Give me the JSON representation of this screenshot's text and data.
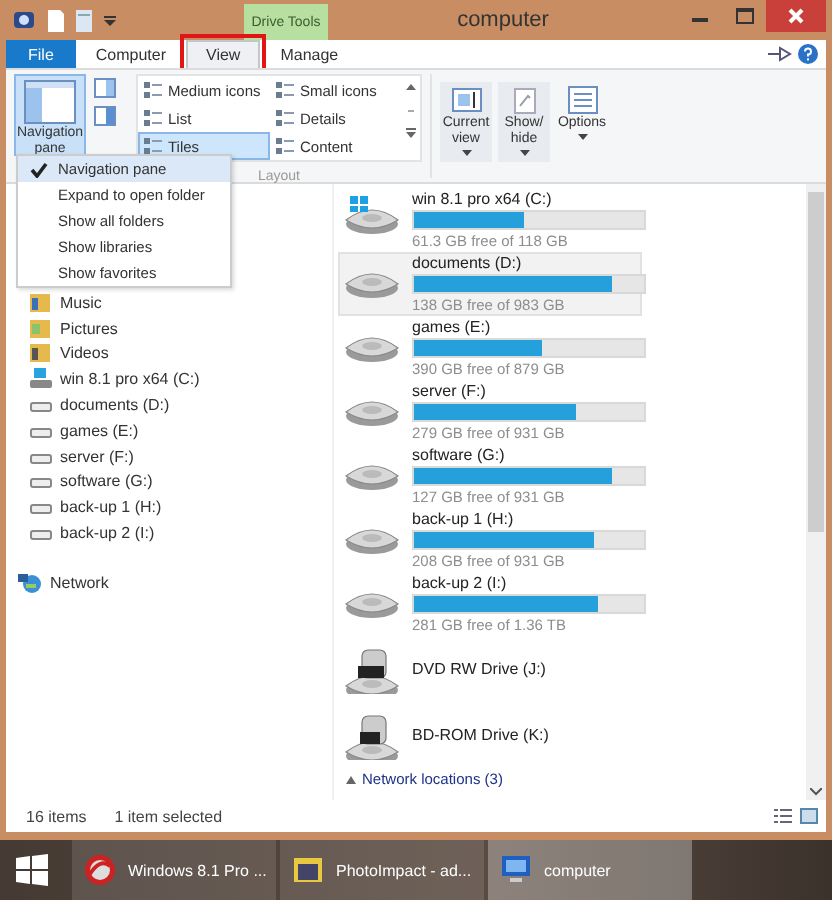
{
  "window": {
    "title": "computer",
    "contextual_tab": "Drive Tools"
  },
  "tabs": [
    {
      "label": "File",
      "kind": "file",
      "selected": false,
      "highlighted": false
    },
    {
      "label": "Computer",
      "kind": "tab",
      "selected": false,
      "highlighted": false
    },
    {
      "label": "View",
      "kind": "tab",
      "selected": true,
      "highlighted": true
    },
    {
      "label": "Manage",
      "kind": "tab",
      "selected": false,
      "highlighted": false
    }
  ],
  "ribbon": {
    "navigation_pane": {
      "label": "Navigation pane",
      "pressed": true
    },
    "layout_options": [
      {
        "label": "Medium icons",
        "selected": false
      },
      {
        "label": "Small icons",
        "selected": false
      },
      {
        "label": "List",
        "selected": false
      },
      {
        "label": "Details",
        "selected": false
      },
      {
        "label": "Tiles",
        "selected": true
      },
      {
        "label": "Content",
        "selected": false
      }
    ],
    "layout_group": "Layout",
    "view_buttons": [
      {
        "label": "Current view",
        "kind": "current"
      },
      {
        "label": "Show/ hide",
        "kind": "showhide"
      },
      {
        "label": "Options",
        "kind": "options"
      }
    ]
  },
  "nav_menu": [
    {
      "label": "Navigation pane",
      "checked": true
    },
    {
      "label": "Expand to open folder",
      "checked": false
    },
    {
      "label": "Show all folders",
      "checked": false
    },
    {
      "label": "Show libraries",
      "checked": false
    },
    {
      "label": "Show favorites",
      "checked": false
    }
  ],
  "sidebar": {
    "items": [
      {
        "label": "Music",
        "kind": "music"
      },
      {
        "label": "Pictures",
        "kind": "pictures"
      },
      {
        "label": "Videos",
        "kind": "videos"
      },
      {
        "label": "win 8.1 pro x64 (C:)",
        "kind": "system"
      },
      {
        "label": "documents (D:)",
        "kind": "drive"
      },
      {
        "label": "games (E:)",
        "kind": "drive"
      },
      {
        "label": "server (F:)",
        "kind": "drive"
      },
      {
        "label": "software (G:)",
        "kind": "drive"
      },
      {
        "label": "back-up 1 (H:)",
        "kind": "drive"
      },
      {
        "label": "back-up 2 (I:)",
        "kind": "drive"
      }
    ],
    "network": "Network"
  },
  "drives": [
    {
      "name": "win 8.1 pro x64 (C:)",
      "free": "61.3 GB free of 118 GB",
      "level": 0.48,
      "kind": "system",
      "selected": false
    },
    {
      "name": "documents (D:)",
      "free": "138 GB free of 983 GB",
      "level": 0.86,
      "kind": "hdd",
      "selected": true
    },
    {
      "name": "games (E:)",
      "free": "390 GB free of 879 GB",
      "level": 0.56,
      "kind": "hdd",
      "selected": false
    },
    {
      "name": "server (F:)",
      "free": "279 GB free of 931 GB",
      "level": 0.7,
      "kind": "hdd",
      "selected": false
    },
    {
      "name": "software (G:)",
      "free": "127 GB free of 931 GB",
      "level": 0.86,
      "kind": "hdd",
      "selected": false
    },
    {
      "name": "back-up 1 (H:)",
      "free": "208 GB free of 931 GB",
      "level": 0.78,
      "kind": "hdd",
      "selected": false
    },
    {
      "name": "back-up 2 (I:)",
      "free": "281 GB free of 1.36 TB",
      "level": 0.8,
      "kind": "hdd",
      "selected": false
    },
    {
      "name": "DVD RW Drive (J:)",
      "kind": "dvd",
      "selected": false
    },
    {
      "name": "BD-ROM Drive (K:)",
      "kind": "bd",
      "selected": false
    }
  ],
  "group_heading": "Network locations (3)",
  "status_bar": {
    "items": "16 items",
    "selection": "1 item selected"
  },
  "taskbar": [
    {
      "label": "Windows 8.1 Pro ...",
      "kind": "browser",
      "active": false
    },
    {
      "label": "PhotoImpact - ad...",
      "kind": "photo",
      "active": false
    },
    {
      "label": "computer",
      "kind": "computer",
      "active": true
    }
  ]
}
